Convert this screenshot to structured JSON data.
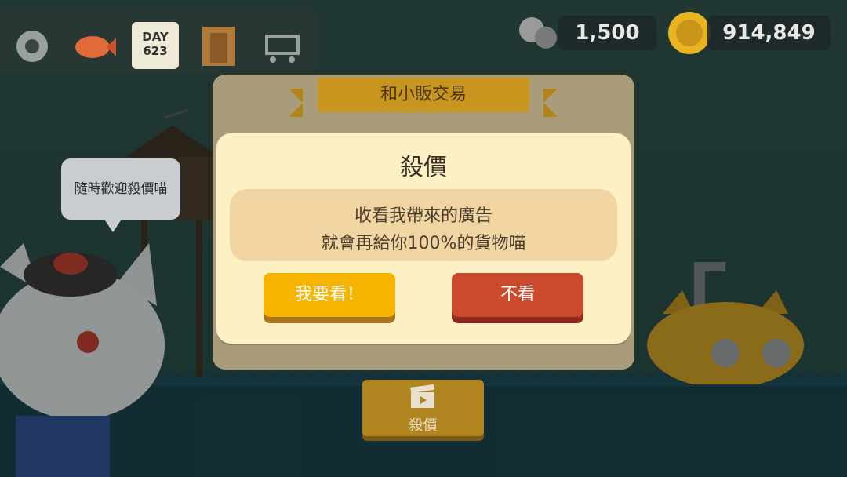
{
  "topbar": {
    "icons": [
      "gear-icon",
      "fish-icon",
      "calendar-icon",
      "door-icon",
      "cart-icon"
    ],
    "calendar": {
      "line1": "DAY",
      "line2": "623"
    }
  },
  "currency": {
    "parts": "1,500",
    "coins": "914,849"
  },
  "npc": {
    "speech": "隨時歡迎殺價喵"
  },
  "trade_panel": {
    "title": "和小販交易"
  },
  "modal": {
    "title": "殺價",
    "message_line1": "收看我帶來的廣告",
    "message_line2": "就會再給你100%的貨物喵",
    "watch_button": "我要看！",
    "decline_button": "不看"
  },
  "bottom_button": {
    "label": "殺價"
  },
  "colors": {
    "modal_bg": "#fdf0c4",
    "watch": "#f5b400",
    "decline": "#c94a2c",
    "ribbon": "#c8961e"
  }
}
